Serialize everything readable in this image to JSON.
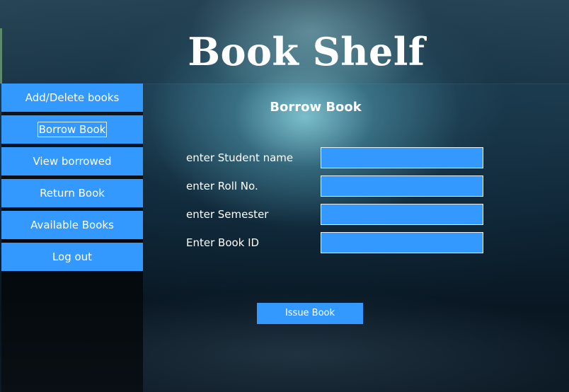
{
  "header": {
    "title": "Book Shelf"
  },
  "sidebar": {
    "items": [
      {
        "label": "Add/Delete books"
      },
      {
        "label": "Borrow Book",
        "selected": true
      },
      {
        "label": "View borrowed"
      },
      {
        "label": "Return Book"
      },
      {
        "label": "Available Books"
      },
      {
        "label": "Log out"
      }
    ]
  },
  "main": {
    "title": "Borrow Book",
    "fields": [
      {
        "label": "enter Student name",
        "value": ""
      },
      {
        "label": "enter Roll No.",
        "value": ""
      },
      {
        "label": "enter Semester",
        "value": ""
      },
      {
        "label": "Enter Book ID",
        "value": ""
      }
    ],
    "issue_label": "Issue Book"
  },
  "colors": {
    "accent": "#3399ff",
    "text": "#ffffff"
  }
}
